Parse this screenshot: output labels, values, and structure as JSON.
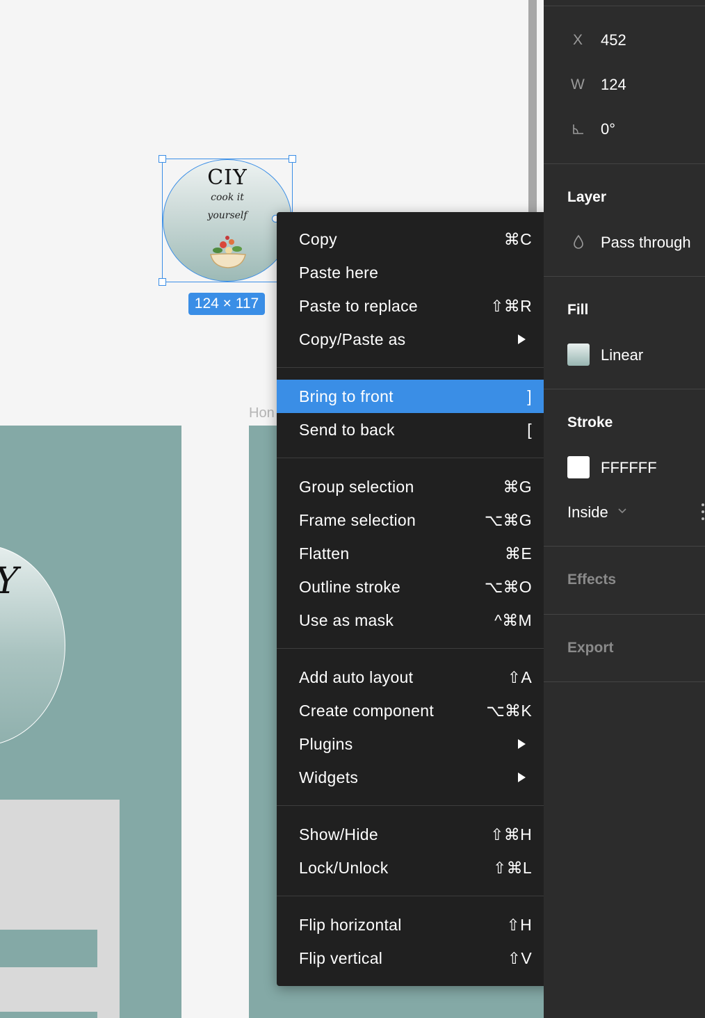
{
  "canvas": {
    "frame_title": "Hon",
    "selection_size": "124 × 117",
    "logo": {
      "title": "CIY",
      "subtitle_line1": "cook it",
      "subtitle_line2": "yourself",
      "big_letter": "Y"
    }
  },
  "context_menu": {
    "items": [
      {
        "label": "Copy",
        "shortcut": "⌘C"
      },
      {
        "label": "Paste here",
        "shortcut": ""
      },
      {
        "label": "Paste to replace",
        "shortcut": "⇧⌘R"
      },
      {
        "label": "Copy/Paste as",
        "shortcut": "",
        "submenu": true
      },
      {
        "label": "Bring to front",
        "shortcut": "]",
        "highlighted": true
      },
      {
        "label": "Send to back",
        "shortcut": "["
      },
      {
        "label": "Group selection",
        "shortcut": "⌘G"
      },
      {
        "label": "Frame selection",
        "shortcut": "⌥⌘G"
      },
      {
        "label": "Flatten",
        "shortcut": "⌘E"
      },
      {
        "label": "Outline stroke",
        "shortcut": "⌥⌘O"
      },
      {
        "label": "Use as mask",
        "shortcut": "^⌘M"
      },
      {
        "label": "Add auto layout",
        "shortcut": "⇧A"
      },
      {
        "label": "Create component",
        "shortcut": "⌥⌘K"
      },
      {
        "label": "Plugins",
        "shortcut": "",
        "submenu": true
      },
      {
        "label": "Widgets",
        "shortcut": "",
        "submenu": true
      },
      {
        "label": "Show/Hide",
        "shortcut": "⇧⌘H"
      },
      {
        "label": "Lock/Unlock",
        "shortcut": "⇧⌘L"
      },
      {
        "label": "Flip horizontal",
        "shortcut": "⇧H"
      },
      {
        "label": "Flip vertical",
        "shortcut": "⇧V"
      }
    ]
  },
  "right_panel": {
    "x_label": "X",
    "x_value": "452",
    "w_label": "W",
    "w_value": "124",
    "rotation_value": "0°",
    "layer_title": "Layer",
    "blend_mode": "Pass through",
    "fill_title": "Fill",
    "fill_type": "Linear",
    "stroke_title": "Stroke",
    "stroke_color": "FFFFFF",
    "stroke_position": "Inside",
    "effects_title": "Effects",
    "export_title": "Export"
  },
  "colors": {
    "accent": "#3a8ee6",
    "menu_bg": "#202020",
    "panel_bg": "#2c2c2c",
    "frame_teal": "#84a9a6"
  },
  "icons": [
    "opacity-drop-icon",
    "rotation-angle-icon",
    "submenu-arrow-icon",
    "chevron-down-icon",
    "more-options-icon",
    "salad-bowl-icon"
  ]
}
